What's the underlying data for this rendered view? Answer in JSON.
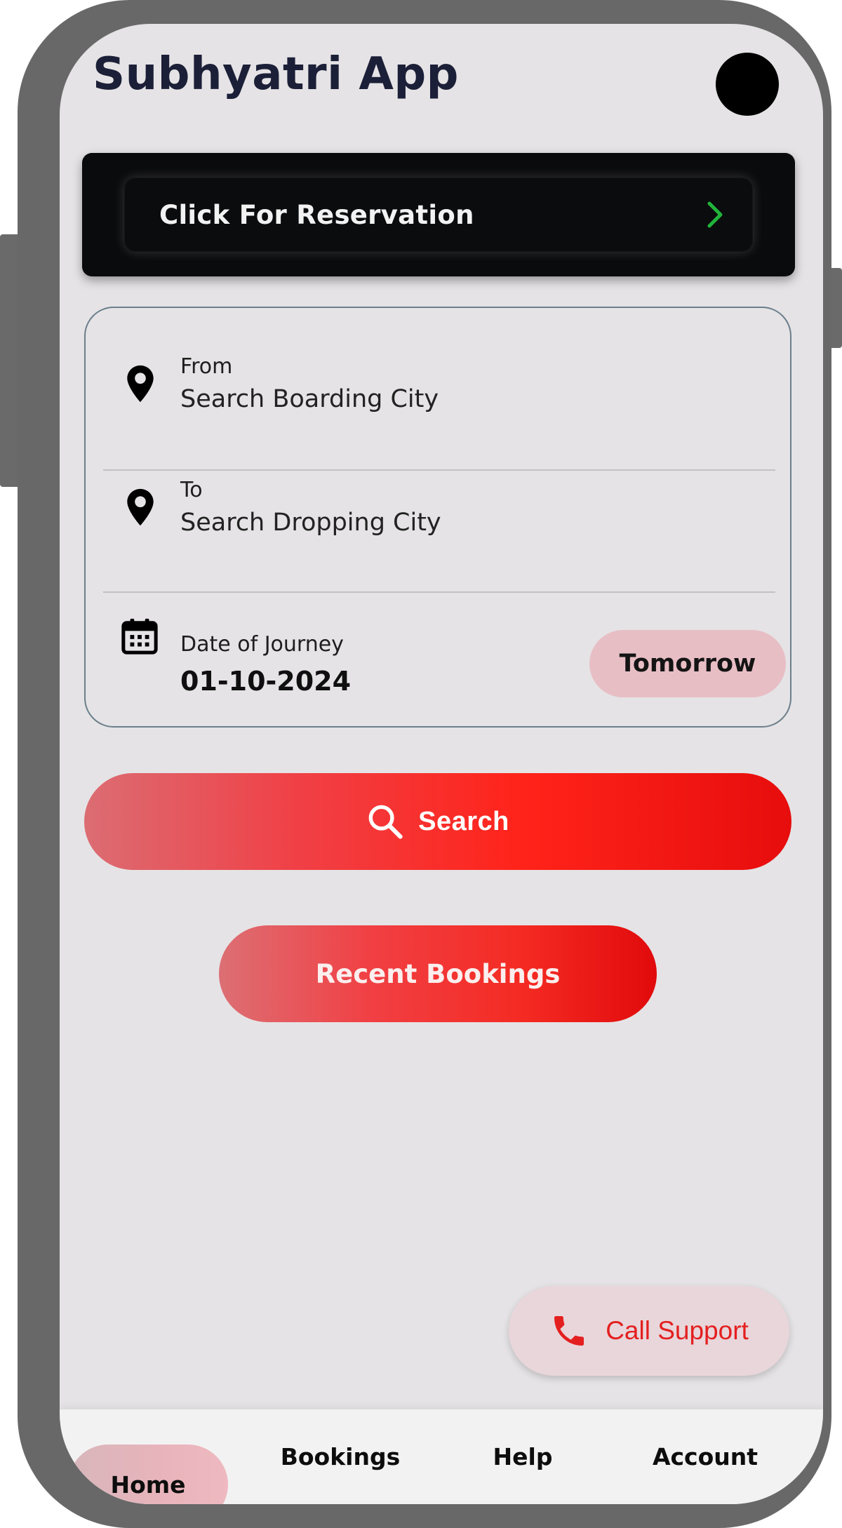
{
  "app": {
    "title": "Subhyatri App"
  },
  "reservation": {
    "label": "Click For Reservation"
  },
  "search_form": {
    "from": {
      "label": "From",
      "placeholder": "Search Boarding City"
    },
    "to": {
      "label": "To",
      "placeholder": "Search Dropping City"
    },
    "date": {
      "label": "Date of Journey",
      "value": "01-10-2024",
      "quick_option": "Tomorrow"
    }
  },
  "actions": {
    "search_label": "Search",
    "recent_bookings_label": "Recent Bookings",
    "call_support_label": "Call Support"
  },
  "nav": {
    "items": [
      {
        "label": "Home",
        "active": true
      },
      {
        "label": "Bookings",
        "active": false
      },
      {
        "label": "Help",
        "active": false
      },
      {
        "label": "Account",
        "active": false
      }
    ]
  },
  "icons": {
    "reservation_chevron": "chevron-right-icon",
    "from": "location-pin-icon",
    "to": "location-pin-icon",
    "date": "calendar-icon",
    "search": "search-icon",
    "call": "phone-icon"
  },
  "colors": {
    "title": "#1b1f37",
    "banner": "#0a0b0d",
    "chevron": "#20b43a",
    "accent_red": "#ff231a",
    "chip_pink": "#e8bec5",
    "call_text": "#e41f1f",
    "screen_bg": "#e5e3e5"
  }
}
